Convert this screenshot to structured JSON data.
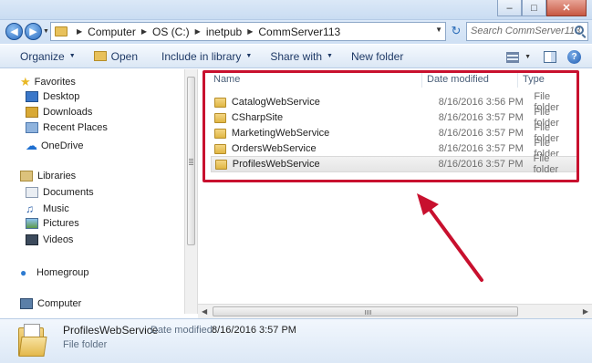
{
  "address": {
    "breadcrumbs": [
      "Computer",
      "OS (C:)",
      "inetpub",
      "CommServer113"
    ],
    "search_placeholder": "Search CommServer113"
  },
  "toolbar": {
    "organize": "Organize",
    "open": "Open",
    "include_in_library": "Include in library",
    "share_with": "Share with",
    "new_folder": "New folder"
  },
  "nav": {
    "favorites": "Favorites",
    "desktop": "Desktop",
    "downloads": "Downloads",
    "recent_places": "Recent Places",
    "onedrive": "OneDrive",
    "libraries": "Libraries",
    "documents": "Documents",
    "music": "Music",
    "pictures": "Pictures",
    "videos": "Videos",
    "homegroup": "Homegroup",
    "computer": "Computer"
  },
  "columns": {
    "name": "Name",
    "date_modified": "Date modified",
    "type": "Type"
  },
  "files": [
    {
      "name": "CatalogWebService",
      "date": "8/16/2016 3:56 PM",
      "type": "File folder"
    },
    {
      "name": "CSharpSite",
      "date": "8/16/2016 3:57 PM",
      "type": "File folder"
    },
    {
      "name": "MarketingWebService",
      "date": "8/16/2016 3:57 PM",
      "type": "File folder"
    },
    {
      "name": "OrdersWebService",
      "date": "8/16/2016 3:57 PM",
      "type": "File folder"
    },
    {
      "name": "ProfilesWebService",
      "date": "8/16/2016 3:57 PM",
      "type": "File folder"
    }
  ],
  "details": {
    "name": "ProfilesWebService",
    "date_label": "Date modified:",
    "date_value": "8/16/2016 3:57 PM",
    "type": "File folder"
  },
  "annotation_color": "#c8102e"
}
